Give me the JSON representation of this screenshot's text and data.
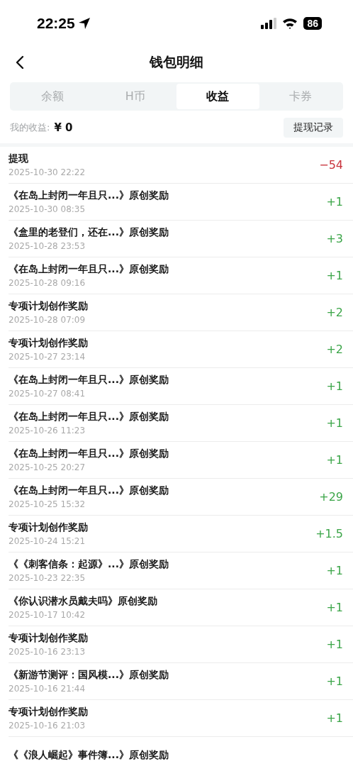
{
  "status_bar": {
    "time": "22:25",
    "battery": "86"
  },
  "header": {
    "title": "钱包明细"
  },
  "tabs": [
    {
      "label": "余额",
      "selected": false
    },
    {
      "label": "H币",
      "selected": false
    },
    {
      "label": "收益",
      "selected": true
    },
    {
      "label": "卡券",
      "selected": false
    }
  ],
  "summary": {
    "label": "我的收益:",
    "amount": "¥ 0",
    "button": "提现记录"
  },
  "transactions": [
    {
      "title": "提现",
      "date": "2025-10-30 22:22",
      "amount": "−54",
      "kind": "expense"
    },
    {
      "title": "《在岛上封闭一年且只...》原创奖励",
      "date": "2025-10-30 08:35",
      "amount": "+1",
      "kind": "income"
    },
    {
      "title": "《盒里的老登们，还在...》原创奖励",
      "date": "2025-10-28 23:53",
      "amount": "+3",
      "kind": "income"
    },
    {
      "title": "《在岛上封闭一年且只...》原创奖励",
      "date": "2025-10-28 09:16",
      "amount": "+1",
      "kind": "income"
    },
    {
      "title": "专项计划创作奖励",
      "date": "2025-10-28 07:09",
      "amount": "+2",
      "kind": "income"
    },
    {
      "title": "专项计划创作奖励",
      "date": "2025-10-27 23:14",
      "amount": "+2",
      "kind": "income"
    },
    {
      "title": "《在岛上封闭一年且只...》原创奖励",
      "date": "2025-10-27 08:41",
      "amount": "+1",
      "kind": "income"
    },
    {
      "title": "《在岛上封闭一年且只...》原创奖励",
      "date": "2025-10-26 11:23",
      "amount": "+1",
      "kind": "income"
    },
    {
      "title": "《在岛上封闭一年且只...》原创奖励",
      "date": "2025-10-25 20:27",
      "amount": "+1",
      "kind": "income"
    },
    {
      "title": "《在岛上封闭一年且只...》原创奖励",
      "date": "2025-10-25 15:32",
      "amount": "+29",
      "kind": "income"
    },
    {
      "title": "专项计划创作奖励",
      "date": "2025-10-24 15:21",
      "amount": "+1.5",
      "kind": "income"
    },
    {
      "title": "《《刺客信条：起源》...》原创奖励",
      "date": "2025-10-23 22:35",
      "amount": "+1",
      "kind": "income"
    },
    {
      "title": "《你认识潜水员戴夫吗》原创奖励",
      "date": "2025-10-17 10:42",
      "amount": "+1",
      "kind": "income"
    },
    {
      "title": "专项计划创作奖励",
      "date": "2025-10-16 23:13",
      "amount": "+1",
      "kind": "income"
    },
    {
      "title": "《新游节测评：国风模...》原创奖励",
      "date": "2025-10-16 21:44",
      "amount": "+1",
      "kind": "income"
    },
    {
      "title": "专项计划创作奖励",
      "date": "2025-10-16 21:03",
      "amount": "+1",
      "kind": "income"
    },
    {
      "title": "《《浪人崛起》事件簿...》原创奖励"
    }
  ]
}
